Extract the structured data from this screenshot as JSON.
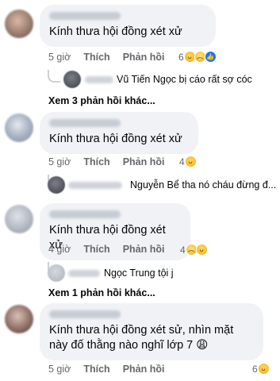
{
  "comments": [
    {
      "text": "Kính thưa hội đồng xét xử",
      "time": "5 giờ",
      "like": "Thích",
      "reply": "Phản hồi",
      "reactions": {
        "count": "6",
        "icons": [
          "haha-icon",
          "sad-icon",
          "like-icon"
        ]
      }
    },
    {
      "text": "Kính thưa hội đồng xét xử",
      "time": "5 giờ",
      "like": "Thích",
      "reply": "Phản hồi",
      "reactions": {
        "count": "4",
        "icons": [
          "haha-icon"
        ]
      }
    },
    {
      "text": "Kính thưa hội đồng xét xử",
      "time": "4 giờ",
      "like": "Thích",
      "reply": "Phản hồi",
      "reactions": {
        "count": "4",
        "icons": [
          "sad-icon",
          "haha-icon"
        ]
      }
    },
    {
      "text": "Kính thưa hội đồng xét sử, nhìn mặt này đố thằng nào nghĩ lớp 7 😩",
      "time": "5 giờ",
      "like": "Thích",
      "reply": "Phản hồi",
      "reactions": {
        "count": "6",
        "icons": [
          "haha-icon"
        ]
      }
    }
  ],
  "replies": [
    {
      "author": "Vũ Tiến Ngọc",
      "text": "bị cáo rất sợ cóc"
    },
    {
      "author": "Nguyễn Bể",
      "text": "tha nó cháu đừng đ..."
    },
    {
      "author": "Ngọc Trung",
      "text": "tội j"
    }
  ],
  "more_replies": [
    "Xem 3 phản hồi khác...",
    "Xem 1 phản hồi khác..."
  ]
}
